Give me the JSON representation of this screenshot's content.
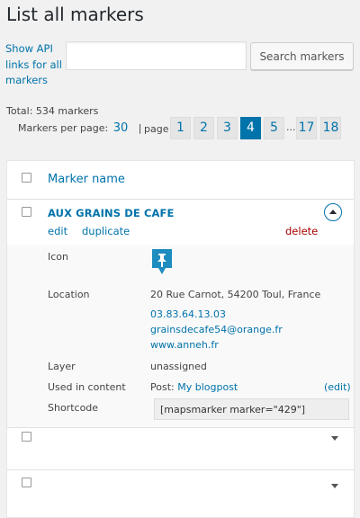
{
  "page": {
    "title": "List all markers"
  },
  "toolbar": {
    "api_link": "Show API links for all markers",
    "search_placeholder": "",
    "search_value": "",
    "search_button": "Search markers"
  },
  "stats": {
    "total": "Total: 534 markers",
    "per_page_label": "Markers per page:",
    "per_page_value": "30",
    "separator": "|",
    "page_label": "page"
  },
  "pagination": {
    "pages": [
      "1",
      "2",
      "3",
      "4",
      "5",
      "17",
      "18"
    ],
    "current": "4",
    "ellipsis": "..."
  },
  "table": {
    "column_header": "Marker name",
    "rows": [
      {
        "name": "AUX GRAINS DE CAFE",
        "actions": {
          "edit": "edit",
          "duplicate": "duplicate",
          "delete": "delete"
        },
        "expanded": true,
        "details": {
          "icon_label": "Icon",
          "location_label": "Location",
          "address": "20 Rue Carnot, 54200 Toul, France",
          "phone": "03.83.64.13.03",
          "email": "grainsdecafe54@orange.fr",
          "website": "www.anneh.fr",
          "layer_label": "Layer",
          "layer_value": "unassigned",
          "used_label": "Used in content",
          "used_prefix": "Post:",
          "used_link": "My blogpost",
          "used_edit": "(edit)",
          "shortcode_label": "Shortcode",
          "shortcode_value": "[mapsmarker marker=\"429\"]"
        }
      },
      {
        "name": "",
        "expanded": false
      },
      {
        "name": "",
        "expanded": false
      }
    ]
  },
  "colors": {
    "accent": "#0073aa",
    "delete": "#aa0000",
    "pin": "#1e8cbe"
  },
  "icons": [
    "expand-toggle-icon",
    "marker-pin-icon",
    "chevron-down-icon"
  ]
}
